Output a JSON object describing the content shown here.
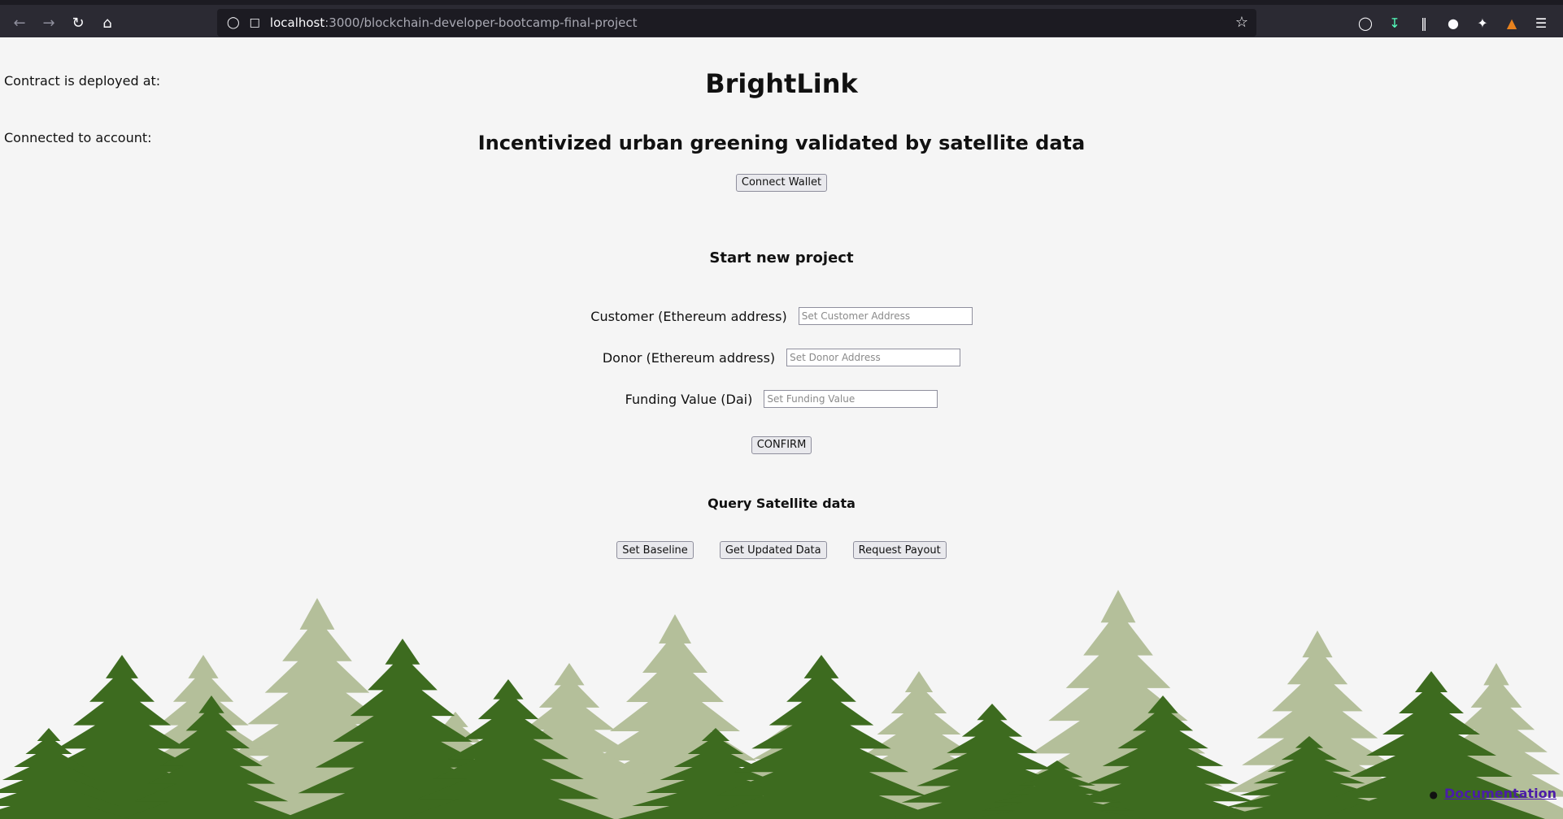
{
  "browser": {
    "url_host": "localhost",
    "url_path": ":3000/blockchain-developer-bootcamp-final-project"
  },
  "page": {
    "contract_label": "Contract is deployed at:",
    "account_label": "Connected to account:",
    "title": "BrightLink",
    "subtitle": "Incentivized urban greening validated by satellite data",
    "connect_wallet": "Connect Wallet"
  },
  "new_project": {
    "heading": "Start new project",
    "customer_label": "Customer (Ethereum address)",
    "customer_placeholder": "Set Customer Address",
    "donor_label": "Donor (Ethereum address)",
    "donor_placeholder": "Set Donor Address",
    "funding_label": "Funding Value (Dai)",
    "funding_placeholder": "Set Funding Value",
    "confirm": "CONFIRM"
  },
  "satellite": {
    "heading": "Query Satellite data",
    "set_baseline": "Set Baseline",
    "get_updated": "Get Updated Data",
    "request_payout": "Request Payout"
  },
  "footer": {
    "documentation": "Documentation"
  },
  "colors": {
    "chrome": "#2b2a33",
    "urlbar": "#1c1b22",
    "page_bg": "#f5f5f5",
    "tree_dark": "#3d6b1f",
    "tree_light": "#b4bf9a",
    "link": "#4b1ca8"
  }
}
